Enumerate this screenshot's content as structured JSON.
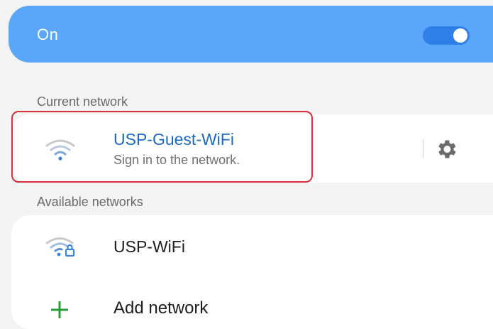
{
  "wifi_toggle": {
    "label": "On",
    "state": "on",
    "accent_color": "#5aa6fb"
  },
  "sections": {
    "current_label": "Current network",
    "available_label": "Available networks"
  },
  "current_network": {
    "name": "USP-Guest-WiFi",
    "status": "Sign in to the network.",
    "icon": "wifi-icon",
    "settings_icon": "gear-icon",
    "name_color": "#1a69c4",
    "highlight_color": "#d9303a"
  },
  "available_networks": [
    {
      "name": "USP-WiFi",
      "icon": "wifi-lock-icon"
    }
  ],
  "add_network": {
    "label": "Add network",
    "icon": "plus-icon",
    "icon_color": "#2a9d3a"
  }
}
